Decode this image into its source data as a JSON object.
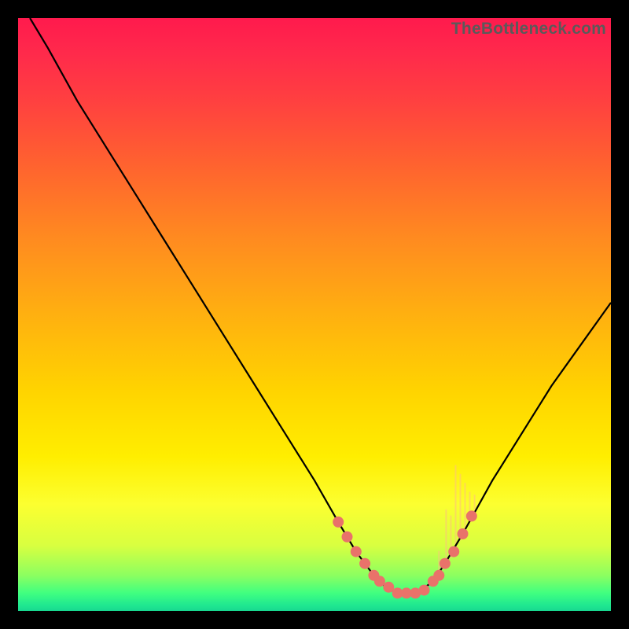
{
  "watermark": "TheBottleneck.com",
  "chart_data": {
    "type": "line",
    "title": "",
    "xlabel": "",
    "ylabel": "",
    "xlim": [
      0,
      100
    ],
    "ylim": [
      0,
      100
    ],
    "series": [
      {
        "name": "curve",
        "x": [
          2,
          5,
          10,
          15,
          20,
          25,
          30,
          35,
          40,
          45,
          50,
          54,
          57,
          60,
          62,
          64,
          66,
          68,
          70,
          72,
          75,
          80,
          85,
          90,
          95,
          100
        ],
        "y": [
          100,
          95,
          86,
          78,
          70,
          62,
          54,
          46,
          38,
          30,
          22,
          15,
          10,
          6,
          4,
          3,
          3,
          3.5,
          5,
          8,
          13,
          22,
          30,
          38,
          45,
          52
        ]
      }
    ],
    "marker_band": {
      "name": "highlight-dots",
      "color": "#e9726a",
      "x": [
        54,
        55.5,
        57,
        58.5,
        60,
        61,
        62.5,
        64,
        65.5,
        67,
        68.5,
        70,
        71,
        72,
        73.5,
        75,
        76.5
      ],
      "y": [
        15,
        12.5,
        10,
        8,
        6,
        5,
        4,
        3,
        3,
        3,
        3.5,
        5,
        6,
        8,
        10,
        13,
        16
      ]
    },
    "spikes": {
      "name": "spikes",
      "color": "#ffbf80",
      "items": [
        {
          "x": 71.0,
          "y_base": 6,
          "h": 4
        },
        {
          "x": 72.2,
          "y_base": 8,
          "h": 9
        },
        {
          "x": 73.0,
          "y_base": 9,
          "h": 7
        },
        {
          "x": 73.8,
          "y_base": 10.5,
          "h": 14
        },
        {
          "x": 74.6,
          "y_base": 12,
          "h": 11
        },
        {
          "x": 75.4,
          "y_base": 13.5,
          "h": 8
        },
        {
          "x": 76.2,
          "y_base": 15,
          "h": 5
        },
        {
          "x": 77.0,
          "y_base": 16.5,
          "h": 3
        }
      ]
    }
  }
}
